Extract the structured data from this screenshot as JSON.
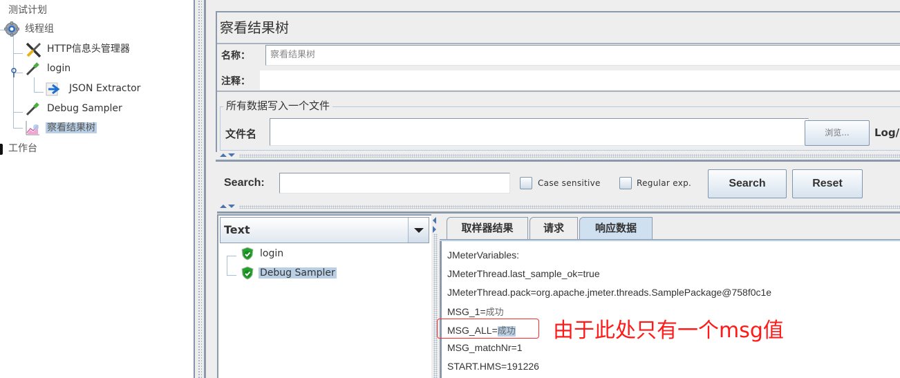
{
  "tree": {
    "items": [
      {
        "label": "测试计划",
        "icon": "test-plan",
        "level": 0
      },
      {
        "label": "线程组",
        "icon": "gear-icon",
        "level": 1
      },
      {
        "label": "HTTP信息头管理器",
        "icon": "wrench-icon",
        "level": 2
      },
      {
        "label": "login",
        "icon": "pipette-icon",
        "level": 2
      },
      {
        "label": "JSON Extractor",
        "icon": "extractor-arrow-icon",
        "level": 3
      },
      {
        "label": "Debug Sampler",
        "icon": "pipette-icon",
        "level": 2
      },
      {
        "label": "察看结果树",
        "icon": "chart-icon",
        "level": 2,
        "selected": true
      },
      {
        "label": "工作台",
        "icon": "workbench-icon",
        "level": 0
      }
    ]
  },
  "panel": {
    "title": "察看结果树",
    "name_label": "名称：",
    "name_value": "察看结果树",
    "comment_label": "注释：",
    "comment_value": "",
    "file_group_label": "所有数据写入一个文件",
    "filename_label": "文件名",
    "filename_value": "",
    "browse_button": "浏览...",
    "log_label": "Log/"
  },
  "search": {
    "label": "Search:",
    "value": "",
    "case_sensitive_label": "Case sensitive",
    "case_sensitive_checked": false,
    "regex_label": "Regular exp.",
    "regex_checked": false,
    "search_button": "Search",
    "reset_button": "Reset"
  },
  "results": {
    "renderer": "Text",
    "samples": [
      {
        "label": "login",
        "status": "success"
      },
      {
        "label": "Debug Sampler",
        "status": "success",
        "selected": true
      }
    ]
  },
  "tabs": [
    {
      "label": "取样器结果",
      "active": false
    },
    {
      "label": "请求",
      "active": false
    },
    {
      "label": "响应数据",
      "active": true
    }
  ],
  "response": {
    "lines": [
      {
        "key": "JMeterVariables:",
        "value": ""
      },
      {
        "key": "JMeterThread.last_sample_ok=true",
        "value": ""
      },
      {
        "key": "JMeterThread.pack=org.apache.jmeter.threads.SamplePackage@758f0c1e",
        "value": ""
      },
      {
        "key": "MSG_1=",
        "value": "成功"
      },
      {
        "key": "MSG_ALL=",
        "value": "成功"
      },
      {
        "key": "MSG_matchNr=1",
        "value": ""
      },
      {
        "key": "START.HMS=191226",
        "value": ""
      }
    ]
  },
  "annotation": {
    "text": "由于此处只有一个msg值",
    "color": "#ff1a1a"
  },
  "colors": {
    "selection": "#b8cfe5",
    "border": "#8a9aab",
    "background": "#eeeeee"
  }
}
